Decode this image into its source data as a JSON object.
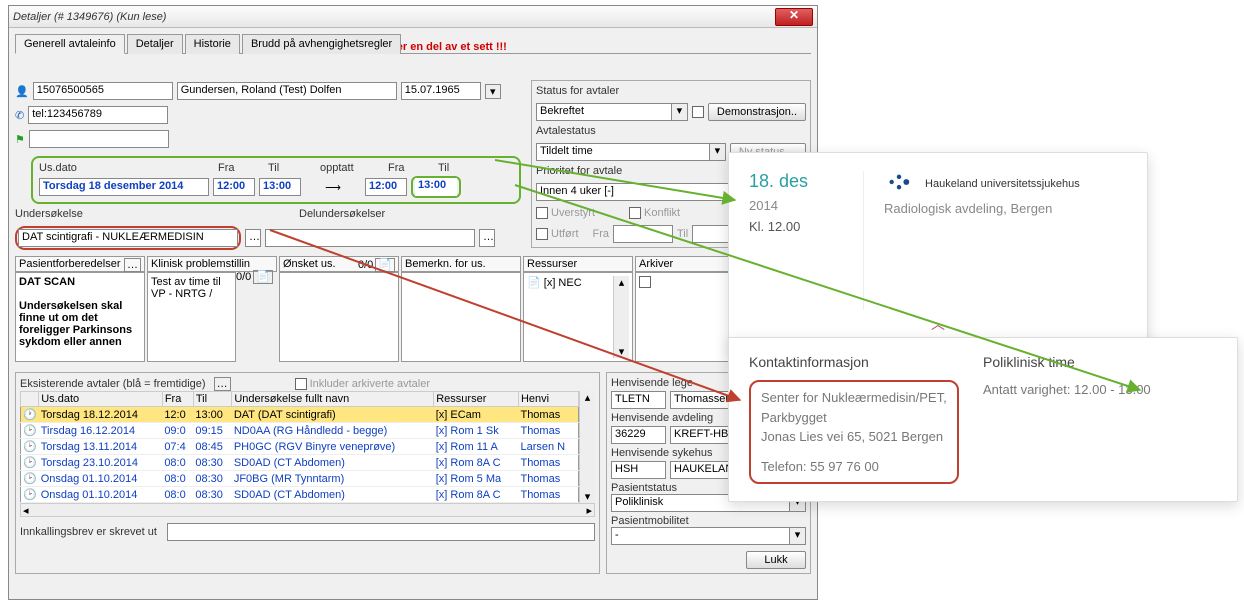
{
  "window": {
    "title": "Detaljer (# 1349676) (Kun lese)",
    "warning": "Denne avtalen er en del av et sett !!!"
  },
  "tabs": [
    "Generell avtaleinfo",
    "Detaljer",
    "Historie",
    "Brudd på avhengighetsregler"
  ],
  "patient": {
    "id": "15076500565",
    "name": "Gundersen, Roland (Test) Dolfen",
    "dob": "15.07.1965",
    "tel_label": "tel:123456789"
  },
  "datetime": {
    "usdato_label": "Us.dato",
    "fra_label": "Fra",
    "til_label": "Til",
    "opptatt_label": "opptatt",
    "usdato": "Torsdag 18 desember 2014",
    "fra1": "12:00",
    "til1": "13:00",
    "fra2": "12:00",
    "til2": "13:00"
  },
  "undersokelse": {
    "label": "Undersøkelse",
    "delus_label": "Delundersøkelser",
    "value": "DAT scintigrafi - NUKLEÆRMEDISIN"
  },
  "status": {
    "group_label": "Status for avtaler",
    "status": "Bekreftet",
    "demo_btn": "Demonstrasjon..",
    "avtalestatus_label": "Avtalestatus",
    "avtalestatus": "Tildelt time",
    "nystatus_btn": "Ny status ...",
    "prioritet_label": "Prioritet for avtale",
    "prioritet": "Innen 4 uker [-]",
    "uverstyrt": "Uverstyrt",
    "konflikt": "Konflikt",
    "utfort": "Utført",
    "fra": "Fra",
    "til": "Til"
  },
  "cols": {
    "pasientforb": "Pasientforberedelser",
    "klinisk": "Klinisk problemstillin",
    "onsket": "Ønsket us.",
    "bemerk": "Bemerkn. for us.",
    "ressurser": "Ressurser",
    "arkiver": "Arkiver",
    "pasientforb_text": "DAT SCAN\n\nUndersøkelsen skal finne ut om det foreligger Parkinsons sykdom eller annen",
    "klinisk_text": "Test av time til VP - NRTG\n/",
    "ressurser_text": "[x] NEC",
    "count00": "0/0"
  },
  "eksisterende": {
    "label": "Eksisterende avtaler (blå = fremtidige)",
    "include_arch": "Inkluder arkiverte avtaler",
    "headers": [
      "",
      "Us.dato",
      "Fra",
      "Til",
      "Undersøkelse fullt navn",
      "Ressurser",
      "Henvi"
    ],
    "rows": [
      {
        "icon": "clock-red",
        "date": "Torsdag  18.12.2014",
        "fra": "12:0",
        "til": "13:00",
        "us": "DAT (DAT scintigrafi)",
        "res": "[x] ECam",
        "hen": "Thomas",
        "hl": true,
        "blue": false
      },
      {
        "icon": "clock",
        "date": "Tirsdag   16.12.2014",
        "fra": "09:0",
        "til": "09:15",
        "us": "ND0AA (RG Håndledd - begge)",
        "res": "[x] Rom 1 Sk",
        "hen": "Thomas",
        "blue": true
      },
      {
        "icon": "clock",
        "date": "Torsdag  13.11.2014",
        "fra": "07:4",
        "til": "08:45",
        "us": "PH0GC (RGV Binyre veneprøve)",
        "res": "[x] Rom 11 A",
        "hen": "Larsen N",
        "blue": true
      },
      {
        "icon": "clock",
        "date": "Torsdag  23.10.2014",
        "fra": "08:0",
        "til": "08:30",
        "us": "SD0AD (CT Abdomen)",
        "res": "[x] Rom 8A C",
        "hen": "Thomas",
        "blue": true
      },
      {
        "icon": "clock",
        "date": "Onsdag  01.10.2014",
        "fra": "08:0",
        "til": "08:30",
        "us": "JF0BG (MR Tynntarm)",
        "res": "[x] Rom 5 Ma",
        "hen": "Thomas",
        "blue": true
      },
      {
        "icon": "clock",
        "date": "Onsdag  01.10.2014",
        "fra": "08:0",
        "til": "08:30",
        "us": "SD0AD (CT Abdomen)",
        "res": "[x] Rom 8A C",
        "hen": "Thomas",
        "blue": true
      }
    ]
  },
  "henvisende": {
    "lege_label": "Henvisende lege",
    "lege_code": "TLETN",
    "lege_name": "Thomassen (testrekvirent)",
    "avd_label": "Henvisende avdeling",
    "avd_code": "36229",
    "avd_name": "KREFT-HBE LUNGE (- , -",
    "syk_label": "Henvisende sykehus",
    "syk_code": "HSH",
    "syk_name": "HAUKELAND SYKEHUS",
    "pasientstatus_label": "Pasientstatus",
    "pasientstatus": "Poliklinisk",
    "mobilitet_label": "Pasientmobilitet",
    "mobilitet": "-"
  },
  "footer": {
    "innkalling": "Innkallingsbrev er skrevet ut",
    "lukk": "Lukk"
  },
  "card": {
    "date": "18. des",
    "year": "2014",
    "time": "Kl. 12.00",
    "hospital": "Haukeland universitetssjukehus",
    "department": "Radiologisk avdeling, Bergen"
  },
  "contact": {
    "title": "Kontaktinformasjon",
    "line1": "Senter for Nukleærmedisin/PET,",
    "line2": "Parkbygget",
    "line3": "Jonas Lies vei 65, 5021 Bergen",
    "phone": "Telefon: 55 97 76 00",
    "poli_title": "Poliklinisk time",
    "poli_text": "Antatt varighet: 12.00 - 13.00"
  }
}
